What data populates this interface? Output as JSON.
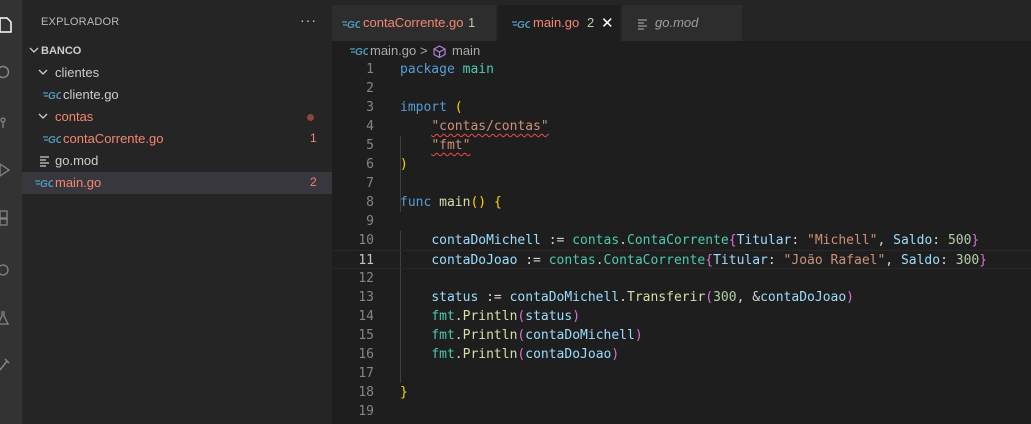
{
  "sidebar": {
    "title": "EXPLORADOR",
    "more": "···",
    "folder": "BANCO",
    "items": [
      {
        "label": "clientes"
      },
      {
        "label": "cliente.go"
      },
      {
        "label": "contas"
      },
      {
        "label": "contaCorrente.go",
        "badge": "1"
      },
      {
        "label": "go.mod"
      },
      {
        "label": "main.go",
        "badge": "2"
      }
    ]
  },
  "tabs": [
    {
      "label": "contaCorrente.go",
      "badge": "1"
    },
    {
      "label": "main.go",
      "badge": "2",
      "close": "✕"
    },
    {
      "label": "go.mod"
    }
  ],
  "breadcrumb": {
    "file": "main.go",
    "separator": ">",
    "symbol": "main"
  },
  "editor": {
    "line_numbers": [
      "1",
      "2",
      "3",
      "4",
      "5",
      "6",
      "7",
      "8",
      "9",
      "10",
      "11",
      "12",
      "13",
      "14",
      "15",
      "16",
      "17",
      "18",
      "19"
    ],
    "code": {
      "l1a": "package",
      "l1b": "main",
      "l3a": "import",
      "l3b": "(",
      "l4": "\"contas/contas\"",
      "l5": "\"fmt\"",
      "l6": ")",
      "l8a": "func",
      "l8b": "main",
      "l8c": "()",
      "l8d": "{",
      "l10a": "contaDoMichell",
      "l10b": " := ",
      "l10c": "contas",
      "l10d": ".",
      "l10e": "ContaCorrente",
      "l10f": "{",
      "l10g": "Titular",
      "l10h": ": ",
      "l10i": "\"Michell\"",
      "l10j": ", ",
      "l10k": "Saldo",
      "l10l": ": ",
      "l10m": "500",
      "l10n": "}",
      "l11a": "contaDoJoao",
      "l11b": " := ",
      "l11c": "contas",
      "l11d": ".",
      "l11e": "ContaCorrente",
      "l11f": "{",
      "l11g": "Titular",
      "l11h": ": ",
      "l11i": "\"João Rafael\"",
      "l11j": ", ",
      "l11k": "Saldo",
      "l11l": ": ",
      "l11m": "300",
      "l11n": "}",
      "l13a": "status",
      "l13b": " := ",
      "l13c": "contaDoMichell",
      "l13d": ".",
      "l13e": "Transferir",
      "l13f": "(",
      "l13g": "300",
      "l13h": ", &",
      "l13i": "contaDoJoao",
      "l13j": ")",
      "l14a": "fmt",
      "l14b": ".",
      "l14c": "Println",
      "l14d": "(",
      "l14e": "status",
      "l14f": ")",
      "l15a": "fmt",
      "l15b": ".",
      "l15c": "Println",
      "l15d": "(",
      "l15e": "contaDoMichell",
      "l15f": ")",
      "l16a": "fmt",
      "l16b": ".",
      "l16c": "Println",
      "l16d": "(",
      "l16e": "contaDoJoao",
      "l16f": ")",
      "l18": "}"
    }
  },
  "colors": {
    "error": "#f48771",
    "keyword": "#569cd6",
    "string": "#ce9178",
    "function": "#dcdcaa",
    "variable": "#9cdcfe"
  }
}
